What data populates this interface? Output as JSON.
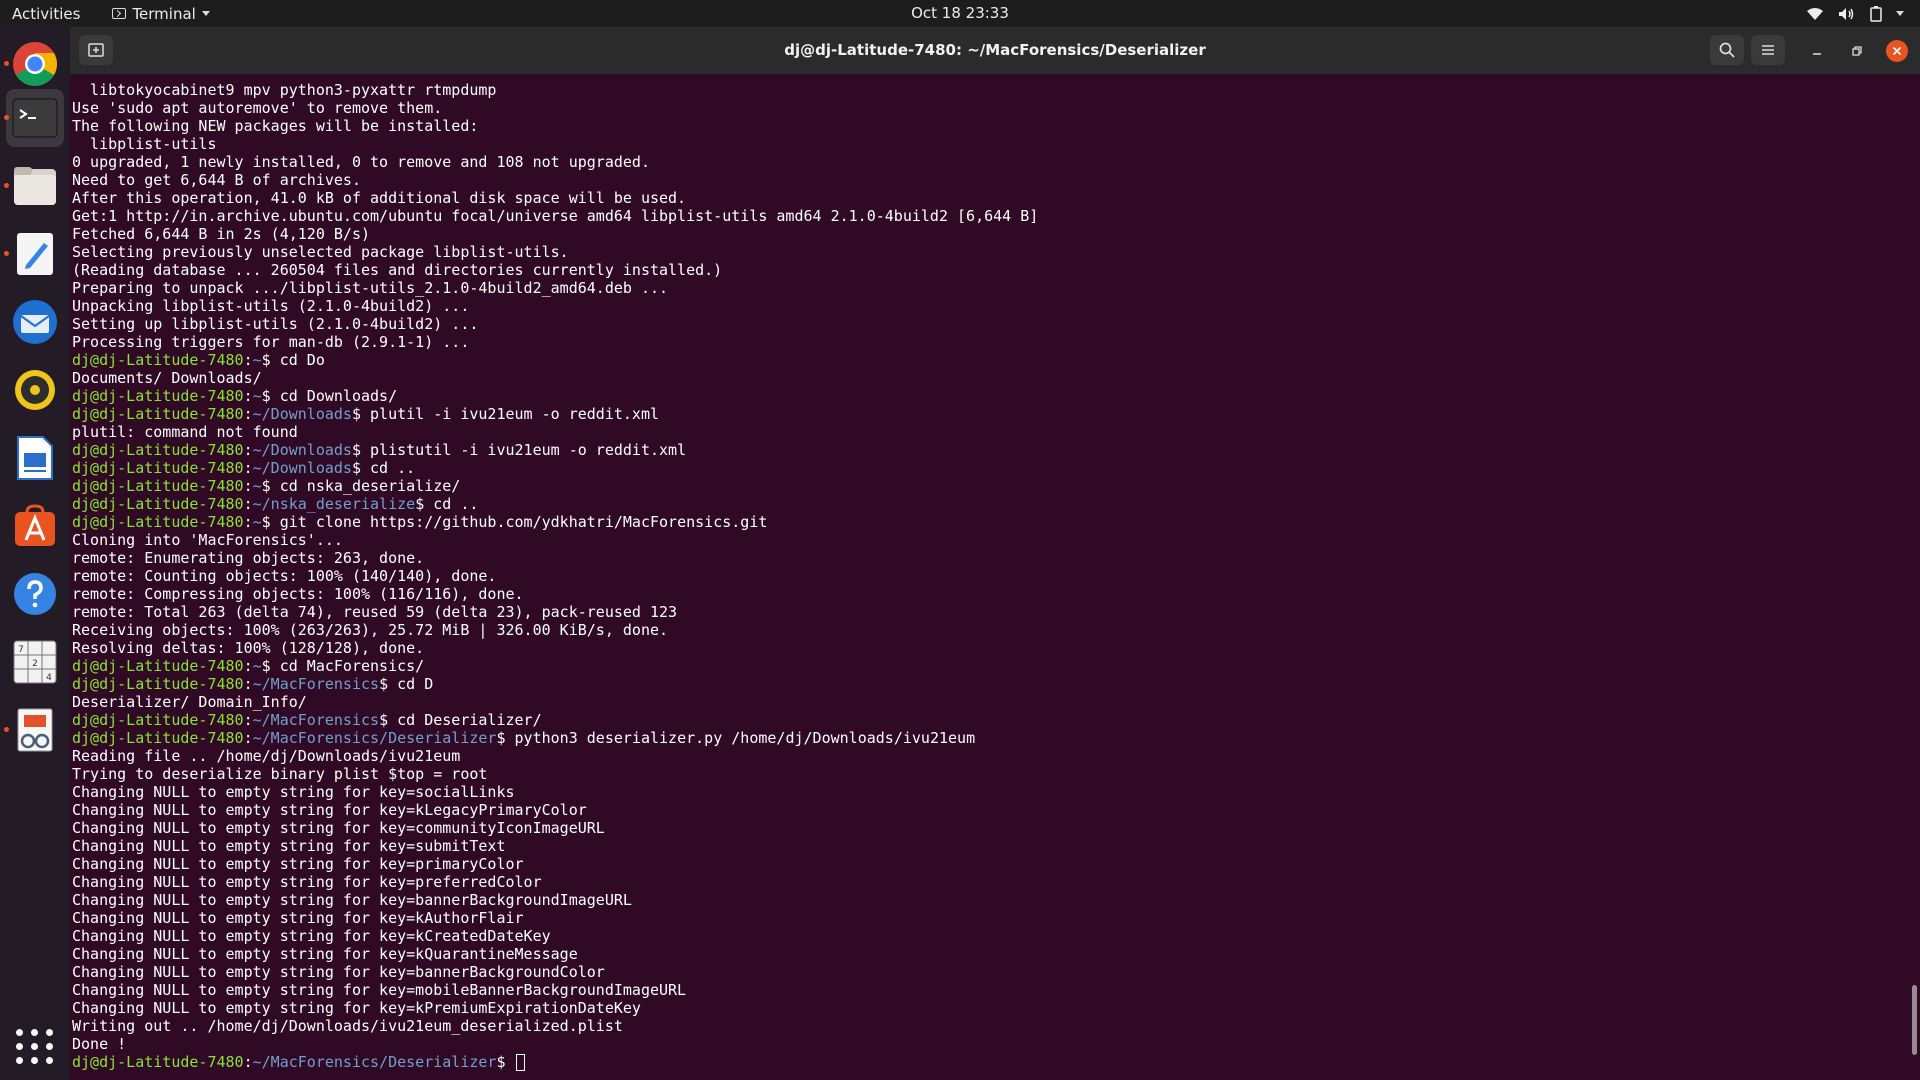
{
  "topbar": {
    "activities": "Activities",
    "app_menu": "Terminal",
    "clock": "Oct 18  23:33"
  },
  "window": {
    "title": "dj@dj-Latitude-7480: ~/MacForensics/Deserializer"
  },
  "dock": {
    "items": [
      {
        "name": "chrome-icon",
        "running": true
      },
      {
        "name": "terminal-icon",
        "running": true,
        "active": true
      },
      {
        "name": "files-icon",
        "running": true
      },
      {
        "name": "text-editor-icon",
        "running": true
      },
      {
        "name": "thunderbird-icon",
        "running": false
      },
      {
        "name": "rhythmbox-icon",
        "running": false
      },
      {
        "name": "libreoffice-writer-icon",
        "running": false
      },
      {
        "name": "software-center-icon",
        "running": false
      },
      {
        "name": "help-icon",
        "running": false
      },
      {
        "name": "sudoku-icon",
        "running": false
      },
      {
        "name": "document-viewer-icon",
        "running": true
      }
    ],
    "show_apps": "show-applications-icon"
  },
  "terminal": {
    "lines": [
      {
        "t": "  libtokyocabinet9 mpv python3-pyxattr rtmpdump"
      },
      {
        "t": "Use 'sudo apt autoremove' to remove them."
      },
      {
        "t": "The following NEW packages will be installed:"
      },
      {
        "t": "  libplist-utils"
      },
      {
        "t": "0 upgraded, 1 newly installed, 0 to remove and 108 not upgraded."
      },
      {
        "t": "Need to get 6,644 B of archives."
      },
      {
        "t": "After this operation, 41.0 kB of additional disk space will be used."
      },
      {
        "t": "Get:1 http://in.archive.ubuntu.com/ubuntu focal/universe amd64 libplist-utils amd64 2.1.0-4build2 [6,644 B]"
      },
      {
        "t": "Fetched 6,644 B in 2s (4,120 B/s)"
      },
      {
        "t": "Selecting previously unselected package libplist-utils."
      },
      {
        "t": "(Reading database ... 260504 files and directories currently installed.)"
      },
      {
        "t": "Preparing to unpack .../libplist-utils_2.1.0-4build2_amd64.deb ..."
      },
      {
        "t": "Unpacking libplist-utils (2.1.0-4build2) ..."
      },
      {
        "t": "Setting up libplist-utils (2.1.0-4build2) ..."
      },
      {
        "t": "Processing triggers for man-db (2.9.1-1) ..."
      },
      {
        "user": "dj@dj-Latitude-7480",
        "path": "~",
        "cmd": "cd Do"
      },
      {
        "t": "Documents/ Downloads/"
      },
      {
        "user": "dj@dj-Latitude-7480",
        "path": "~",
        "cmd": "cd Downloads/"
      },
      {
        "user": "dj@dj-Latitude-7480",
        "path": "~/Downloads",
        "cmd": "plutil -i ivu21eum -o reddit.xml"
      },
      {
        "t": "plutil: command not found"
      },
      {
        "user": "dj@dj-Latitude-7480",
        "path": "~/Downloads",
        "cmd": "plistutil -i ivu21eum -o reddit.xml"
      },
      {
        "user": "dj@dj-Latitude-7480",
        "path": "~/Downloads",
        "cmd": "cd .."
      },
      {
        "user": "dj@dj-Latitude-7480",
        "path": "~",
        "cmd": "cd nska_deserialize/"
      },
      {
        "user": "dj@dj-Latitude-7480",
        "path": "~/nska_deserialize",
        "cmd": "cd .."
      },
      {
        "user": "dj@dj-Latitude-7480",
        "path": "~",
        "cmd": "git clone https://github.com/ydkhatri/MacForensics.git"
      },
      {
        "t": "Cloning into 'MacForensics'..."
      },
      {
        "t": "remote: Enumerating objects: 263, done."
      },
      {
        "t": "remote: Counting objects: 100% (140/140), done."
      },
      {
        "t": "remote: Compressing objects: 100% (116/116), done."
      },
      {
        "t": "remote: Total 263 (delta 74), reused 59 (delta 23), pack-reused 123"
      },
      {
        "t": "Receiving objects: 100% (263/263), 25.72 MiB | 326.00 KiB/s, done."
      },
      {
        "t": "Resolving deltas: 100% (128/128), done."
      },
      {
        "user": "dj@dj-Latitude-7480",
        "path": "~",
        "cmd": "cd MacForensics/"
      },
      {
        "user": "dj@dj-Latitude-7480",
        "path": "~/MacForensics",
        "cmd": "cd D"
      },
      {
        "t": "Deserializer/ Domain_Info/"
      },
      {
        "user": "dj@dj-Latitude-7480",
        "path": "~/MacForensics",
        "cmd": "cd Deserializer/"
      },
      {
        "user": "dj@dj-Latitude-7480",
        "path": "~/MacForensics/Deserializer",
        "cmd": "python3 deserializer.py /home/dj/Downloads/ivu21eum"
      },
      {
        "t": "Reading file .. /home/dj/Downloads/ivu21eum"
      },
      {
        "t": "Trying to deserialize binary plist $top = root"
      },
      {
        "t": "Changing NULL to empty string for key=socialLinks"
      },
      {
        "t": "Changing NULL to empty string for key=kLegacyPrimaryColor"
      },
      {
        "t": "Changing NULL to empty string for key=communityIconImageURL"
      },
      {
        "t": "Changing NULL to empty string for key=submitText"
      },
      {
        "t": "Changing NULL to empty string for key=primaryColor"
      },
      {
        "t": "Changing NULL to empty string for key=preferredColor"
      },
      {
        "t": "Changing NULL to empty string for key=bannerBackgroundImageURL"
      },
      {
        "t": "Changing NULL to empty string for key=kAuthorFlair"
      },
      {
        "t": "Changing NULL to empty string for key=kCreatedDateKey"
      },
      {
        "t": "Changing NULL to empty string for key=kQuarantineMessage"
      },
      {
        "t": "Changing NULL to empty string for key=bannerBackgroundColor"
      },
      {
        "t": "Changing NULL to empty string for key=mobileBannerBackgroundImageURL"
      },
      {
        "t": "Changing NULL to empty string for key=kPremiumExpirationDateKey"
      },
      {
        "t": "Writing out .. /home/dj/Downloads/ivu21eum_deserialized.plist"
      },
      {
        "t": "Done !"
      },
      {
        "user": "dj@dj-Latitude-7480",
        "path": "~/MacForensics/Deserializer",
        "cmd": "",
        "cursor": true
      }
    ]
  },
  "colors": {
    "terminal_bg": "#300a24",
    "user_green": "#8ae234",
    "path_blue": "#729fcf",
    "accent_orange": "#e95420"
  }
}
